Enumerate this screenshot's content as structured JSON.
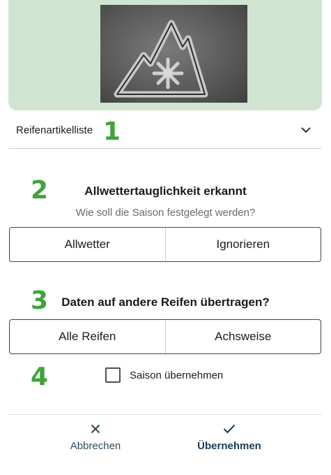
{
  "list_row": {
    "label": "Reifenartikelliste",
    "icon": "chevron-down-icon"
  },
  "steps": [
    "1",
    "2",
    "3",
    "4"
  ],
  "section_season": {
    "title": "Allwettertauglichkeit erkannt",
    "question": "Wie soll die Saison festgelegt werden?",
    "options": [
      "Allwetter",
      "Ignorieren"
    ]
  },
  "section_transfer": {
    "title": "Daten auf andere Reifen übertragen?",
    "options": [
      "Alle Reifen",
      "Achsweise"
    ]
  },
  "checkbox": {
    "label": "Saison übernehmen",
    "checked": false
  },
  "footer": {
    "cancel_label": "Abbrechen",
    "cancel_icon": "close-icon",
    "confirm_label": "Übernehmen",
    "confirm_icon": "checkmark-icon"
  },
  "colors": {
    "hero_bg": "#cfe5d1",
    "step_number": "#3ea43b",
    "segment_border": "#3a4654",
    "action_text": "#1b3b52"
  }
}
